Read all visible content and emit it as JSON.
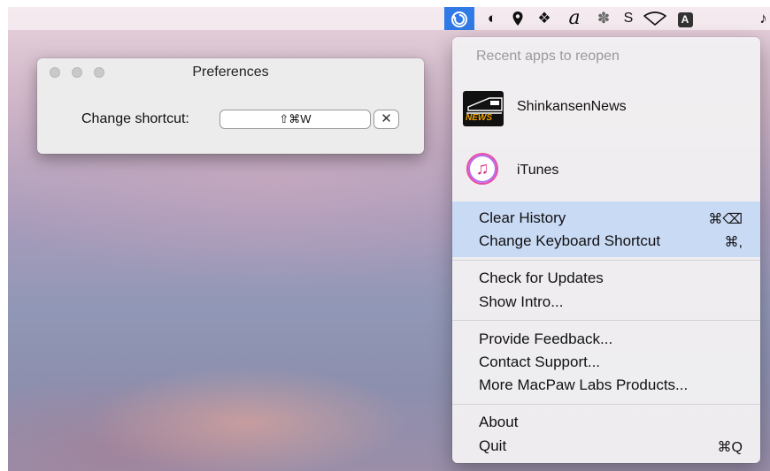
{
  "menubar": {
    "items": [
      {
        "name": "app-active-icon",
        "glyph": ""
      },
      {
        "name": "moon-icon",
        "glyph": "◐"
      },
      {
        "name": "location-pin-icon",
        "glyph": "📍"
      },
      {
        "name": "dropbox-icon",
        "glyph": "❖"
      },
      {
        "name": "script-a-icon",
        "glyph": "𝒶"
      },
      {
        "name": "bluetooth-icon",
        "glyph": "✽"
      },
      {
        "name": "s-icon",
        "glyph": "S"
      },
      {
        "name": "wifi-icon",
        "glyph": "♡"
      },
      {
        "name": "input-source-icon",
        "glyph": "A"
      },
      {
        "name": "music-icon",
        "glyph": "♪"
      }
    ]
  },
  "prefs": {
    "title": "Preferences",
    "label": "Change shortcut:",
    "shortcut_value": "⇧⌘W",
    "clear_glyph": "✕"
  },
  "menu": {
    "header": "Recent apps to reopen",
    "apps": [
      {
        "name": "ShinkansenNews",
        "icon": "news-icon",
        "icon_text": "NEWS"
      },
      {
        "name": "iTunes",
        "icon": "music-note-icon",
        "icon_text": "♫"
      }
    ],
    "groups": [
      {
        "items": [
          {
            "label": "Clear History",
            "shortcut": "⌘⌫"
          },
          {
            "label": "Change Keyboard Shortcut",
            "shortcut": "⌘,"
          }
        ]
      },
      {
        "items": [
          {
            "label": "Check for Updates",
            "shortcut": ""
          },
          {
            "label": "Show Intro...",
            "shortcut": ""
          }
        ]
      },
      {
        "items": [
          {
            "label": "Provide Feedback...",
            "shortcut": ""
          },
          {
            "label": "Contact Support...",
            "shortcut": ""
          },
          {
            "label": "More MacPaw Labs Products...",
            "shortcut": ""
          }
        ]
      },
      {
        "items": [
          {
            "label": "About",
            "shortcut": ""
          },
          {
            "label": "Quit",
            "shortcut": "⌘Q"
          }
        ]
      }
    ]
  },
  "colors": {
    "accent": "#2f7ae6",
    "highlight": "#c9daf4"
  }
}
